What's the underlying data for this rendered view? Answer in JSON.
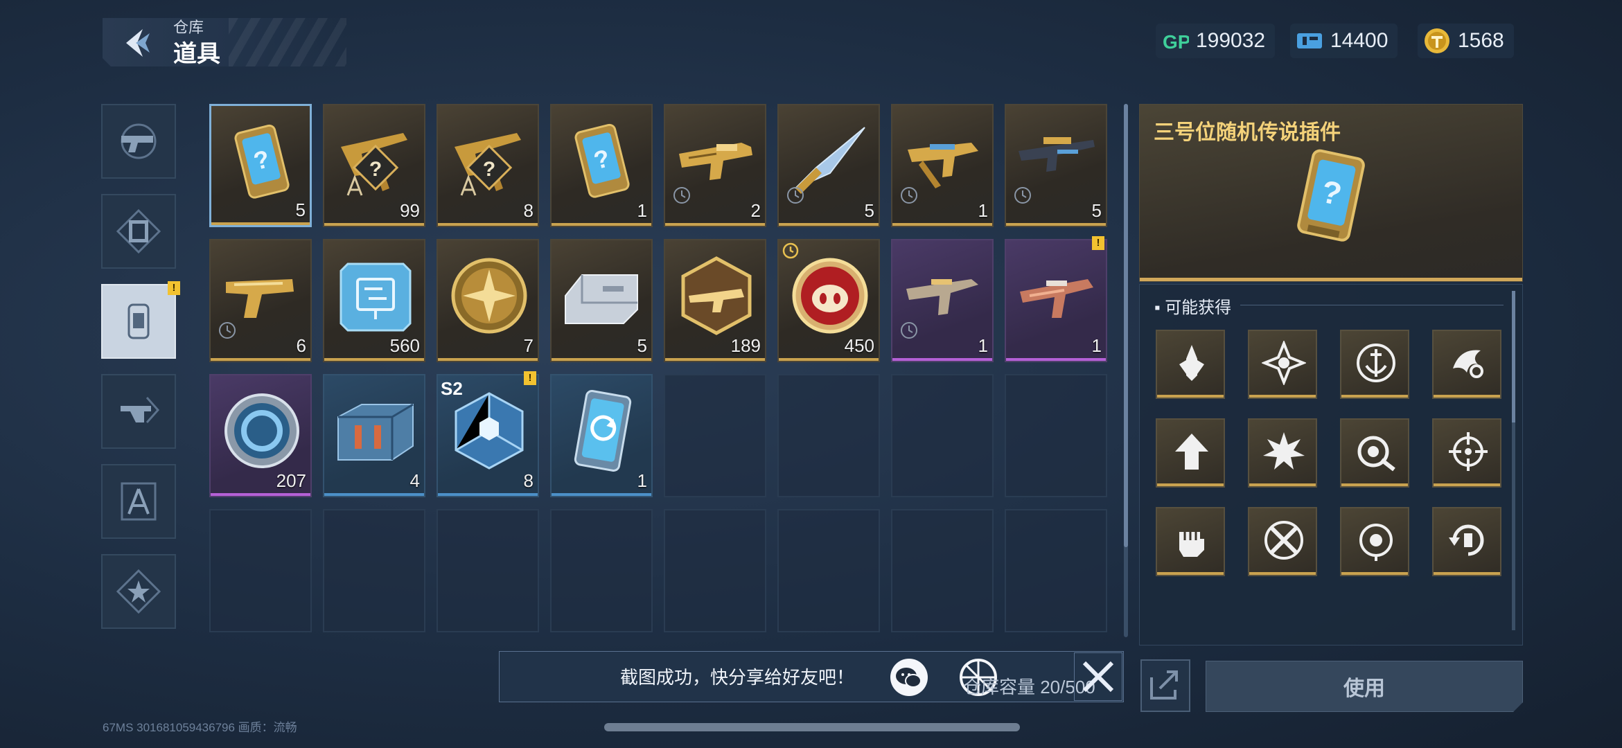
{
  "header": {
    "subtitle": "仓库",
    "title": "道具"
  },
  "currencies": [
    {
      "icon": "gp-icon",
      "value": "199032"
    },
    {
      "icon": "ticket-icon",
      "value": "14400"
    },
    {
      "icon": "coin-icon",
      "value": "1568"
    }
  ],
  "categories": [
    {
      "name": "weapon-category-tab",
      "icon": "pistol-icon"
    },
    {
      "name": "card-category-tab",
      "icon": "card-icon"
    },
    {
      "name": "item-category-tab",
      "icon": "chip-icon",
      "active": true,
      "badge": "!"
    },
    {
      "name": "weapon-mod-category-tab",
      "icon": "weapon-mod-icon"
    },
    {
      "name": "blueprint-category-tab",
      "icon": "compass-icon"
    },
    {
      "name": "star-category-tab",
      "icon": "star-icon"
    }
  ],
  "items": [
    {
      "icon": "mystery-card-icon",
      "count": "5",
      "rarity": "gold",
      "selected": true
    },
    {
      "icon": "mystery-rifle-blueprint-icon",
      "count": "99",
      "rarity": "gold"
    },
    {
      "icon": "mystery-rifle-blueprint-icon",
      "count": "8",
      "rarity": "gold"
    },
    {
      "icon": "mystery-card-icon",
      "count": "1",
      "rarity": "gold"
    },
    {
      "icon": "gold-rifle-icon",
      "count": "2",
      "rarity": "gold",
      "timed": true
    },
    {
      "icon": "gold-knife-icon",
      "count": "5",
      "rarity": "gold",
      "timed": true
    },
    {
      "icon": "gold-smg-icon",
      "count": "1",
      "rarity": "gold",
      "timed": true
    },
    {
      "icon": "gold-sniper-icon",
      "count": "5",
      "rarity": "gold",
      "timed": true
    },
    {
      "icon": "gold-pistol-icon",
      "count": "6",
      "rarity": "gold",
      "timed": true
    },
    {
      "icon": "circuit-chip-icon",
      "count": "560",
      "rarity": "gold"
    },
    {
      "icon": "gold-cross-medal-icon",
      "count": "7",
      "rarity": "gold"
    },
    {
      "icon": "silver-ingot-icon",
      "count": "5",
      "rarity": "gold"
    },
    {
      "icon": "hex-weapon-badge-icon",
      "count": "189",
      "rarity": "gold"
    },
    {
      "icon": "pig-coin-icon",
      "count": "450",
      "rarity": "gold",
      "limited": true
    },
    {
      "icon": "purple-rifle-icon",
      "count": "1",
      "rarity": "purple",
      "timed": true
    },
    {
      "icon": "purple-assault-rifle-icon",
      "count": "1",
      "rarity": "purple",
      "warn": "!"
    },
    {
      "icon": "ring-token-icon",
      "count": "207",
      "rarity": "purple"
    },
    {
      "icon": "supply-crate-icon",
      "count": "4",
      "rarity": "blue"
    },
    {
      "icon": "crystal-cube-icon",
      "count": "8",
      "rarity": "blue",
      "season": "S2",
      "warn": "!"
    },
    {
      "icon": "refresh-card-icon",
      "count": "1",
      "rarity": "blue"
    }
  ],
  "detail": {
    "title": "三号位随机传说插件",
    "possible_label": "可能获得",
    "rewards": [
      "missile-perk-icon",
      "star-burst-perk-icon",
      "anchor-perk-icon",
      "flame-perk-icon",
      "arrow-up-perk-icon",
      "explosion-perk-icon",
      "target-perk-icon",
      "crosshair-perk-icon",
      "fist-perk-icon",
      "cross-swords-perk-icon",
      "scope-perk-icon",
      "reload-perk-icon"
    ]
  },
  "toast": {
    "message": "截图成功，快分享给好友吧！"
  },
  "capacity": "仓库容量 20/500",
  "use_label": "使用",
  "status": "67MS   3016810594367​96        画质：流畅"
}
